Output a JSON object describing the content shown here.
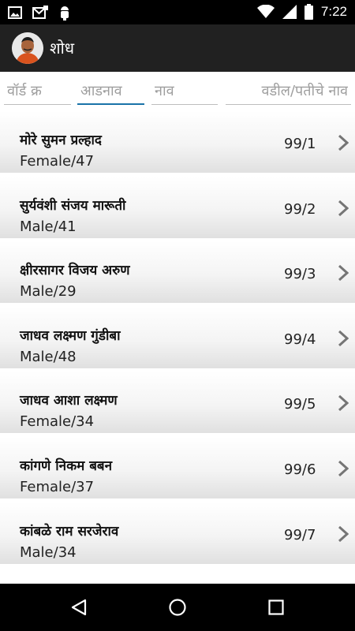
{
  "status_bar": {
    "time": "7:22",
    "icons": [
      "gallery-icon",
      "mail-icon",
      "android-debug-icon",
      "wifi-icon",
      "signal-icon",
      "battery-icon"
    ]
  },
  "app_bar": {
    "title": "शोध",
    "avatar": "avatar"
  },
  "search": {
    "ward_placeholder": "वॉर्ड क्र",
    "surname_placeholder": "आडनाव",
    "name_placeholder": "नाव",
    "father_placeholder": "वडील/पतीचे नाव"
  },
  "voters": [
    {
      "name": "मोरे सुमन प्रल्हाद",
      "details": "Female/47",
      "number": "99/1"
    },
    {
      "name": "सुर्यवंशी संजय मारूती",
      "details": "Male/41",
      "number": "99/2"
    },
    {
      "name": "क्षीरसागर विजय अरुण",
      "details": "Male/29",
      "number": "99/3"
    },
    {
      "name": "जाधव लक्ष्मण गुंडीबा",
      "details": "Male/48",
      "number": "99/4"
    },
    {
      "name": "जाधव आशा लक्ष्मण",
      "details": "Female/34",
      "number": "99/5"
    },
    {
      "name": "कांगणे निकम बबन",
      "details": "Female/37",
      "number": "99/6"
    },
    {
      "name": "कांबळे राम सरजेराव",
      "details": "Male/34",
      "number": "99/7"
    }
  ],
  "colors": {
    "app_bar": "#212121",
    "focus_accent": "#1a73a8",
    "status_bar": "#000000"
  }
}
